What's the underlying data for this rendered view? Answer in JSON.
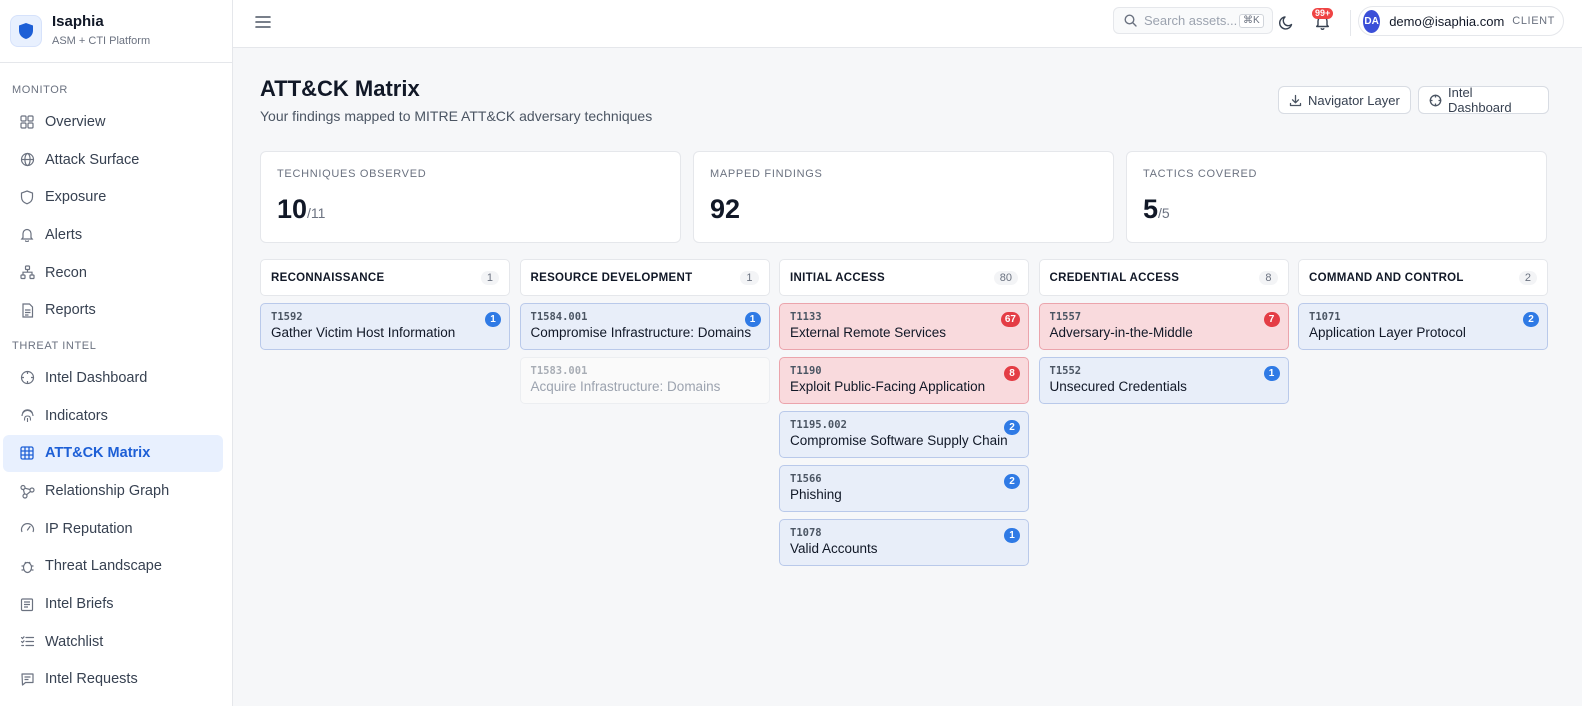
{
  "brand": {
    "name": "Isaphia",
    "subtitle": "ASM + CTI Platform"
  },
  "sidebar": {
    "sections": [
      {
        "label": "MONITOR",
        "items": [
          {
            "label": "Overview",
            "icon": "grid-icon"
          },
          {
            "label": "Attack Surface",
            "icon": "globe-icon"
          },
          {
            "label": "Exposure",
            "icon": "shield-icon"
          },
          {
            "label": "Alerts",
            "icon": "bell-icon"
          },
          {
            "label": "Recon",
            "icon": "network-icon"
          },
          {
            "label": "Reports",
            "icon": "document-icon"
          }
        ]
      },
      {
        "label": "THREAT INTEL",
        "items": [
          {
            "label": "Intel Dashboard",
            "icon": "crosshair-icon"
          },
          {
            "label": "Indicators",
            "icon": "fingerprint-icon"
          },
          {
            "label": "ATT&CK Matrix",
            "icon": "table-grid-icon",
            "active": true
          },
          {
            "label": "Relationship Graph",
            "icon": "graph-icon"
          },
          {
            "label": "IP Reputation",
            "icon": "gauge-icon"
          },
          {
            "label": "Threat Landscape",
            "icon": "bug-icon"
          },
          {
            "label": "Intel Briefs",
            "icon": "newspaper-icon"
          },
          {
            "label": "Watchlist",
            "icon": "list-icon"
          },
          {
            "label": "Intel Requests",
            "icon": "message-icon"
          }
        ]
      }
    ]
  },
  "topbar": {
    "search_placeholder": "Search assets...",
    "search_shortcut": "⌘K",
    "notification_count": "99+",
    "user_initials": "DA",
    "user_email": "demo@isaphia.com",
    "user_role": "CLIENT"
  },
  "page": {
    "title": "ATT&CK Matrix",
    "subtitle": "Your findings mapped to MITRE ATT&CK adversary techniques",
    "navigator_button": "Navigator Layer",
    "intel_button": "Intel Dashboard"
  },
  "stats": [
    {
      "label": "TECHNIQUES OBSERVED",
      "value": "10",
      "total": "/11"
    },
    {
      "label": "MAPPED FINDINGS",
      "value": "92",
      "total": ""
    },
    {
      "label": "TACTICS COVERED",
      "value": "5",
      "total": "/5"
    }
  ],
  "tactics": [
    {
      "name": "RECONNAISSANCE",
      "count": "1",
      "techniques": [
        {
          "id": "T1592",
          "name": "Gather Victim Host Information",
          "count": "1",
          "level": "normal"
        }
      ]
    },
    {
      "name": "RESOURCE DEVELOPMENT",
      "count": "1",
      "techniques": [
        {
          "id": "T1584.001",
          "name": "Compromise Infrastructure: Domains",
          "count": "1",
          "level": "normal"
        },
        {
          "id": "T1583.001",
          "name": "Acquire Infrastructure: Domains",
          "count": "",
          "level": "dim"
        }
      ]
    },
    {
      "name": "INITIAL ACCESS",
      "count": "80",
      "techniques": [
        {
          "id": "T1133",
          "name": "External Remote Services",
          "count": "67",
          "level": "hot"
        },
        {
          "id": "T1190",
          "name": "Exploit Public-Facing Application",
          "count": "8",
          "level": "hot"
        },
        {
          "id": "T1195.002",
          "name": "Compromise Software Supply Chain",
          "count": "2",
          "level": "normal"
        },
        {
          "id": "T1566",
          "name": "Phishing",
          "count": "2",
          "level": "normal"
        },
        {
          "id": "T1078",
          "name": "Valid Accounts",
          "count": "1",
          "level": "normal"
        }
      ]
    },
    {
      "name": "CREDENTIAL ACCESS",
      "count": "8",
      "techniques": [
        {
          "id": "T1557",
          "name": "Adversary-in-the-Middle",
          "count": "7",
          "level": "hot"
        },
        {
          "id": "T1552",
          "name": "Unsecured Credentials",
          "count": "1",
          "level": "normal"
        }
      ]
    },
    {
      "name": "COMMAND AND CONTROL",
      "count": "2",
      "techniques": [
        {
          "id": "T1071",
          "name": "Application Layer Protocol",
          "count": "2",
          "level": "normal"
        }
      ]
    }
  ],
  "colors": {
    "accent": "#1d5fd6",
    "hot": "#e43d45",
    "badge": "#2f7ae5"
  }
}
